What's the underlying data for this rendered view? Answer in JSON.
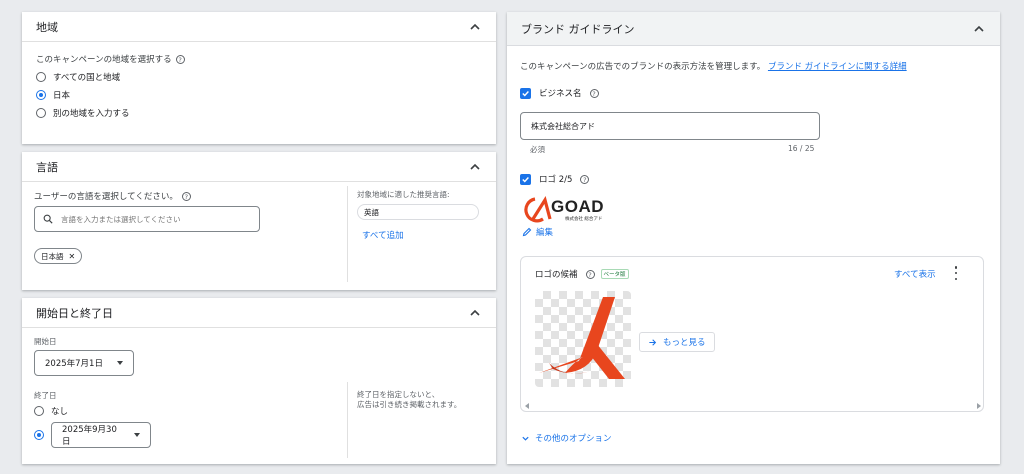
{
  "region": {
    "title": "地域",
    "prompt": "このキャンペーンの地域を選択する",
    "options": [
      "すべての国と地域",
      "日本",
      "別の地域を入力する"
    ],
    "selected_index": 1
  },
  "language": {
    "title": "言語",
    "prompt": "ユーザーの言語を選択してください。",
    "search_placeholder": "言語を入力または選択してください",
    "chip": "日本語",
    "recommend_title": "対象地域に適した推奨言語:",
    "recommend_chip": "英語",
    "add_all": "すべて追加"
  },
  "dates": {
    "title": "開始日と終了日",
    "start_label": "開始日",
    "start_value": "2025年7月1日",
    "end_label": "終了日",
    "end_none": "なし",
    "end_value": "2025年9月30日",
    "note_line1": "終了日を指定しないと、",
    "note_line2": "広告は引き続き掲載されます。"
  },
  "brand": {
    "title": "ブランド ガイドライン",
    "description": "このキャンペーンの広告でのブランドの表示方法を管理します。",
    "description_link": "ブランド ガイドラインに関する詳細",
    "business_label": "ビジネス名",
    "business_value": "株式会社総合アド",
    "required": "必須",
    "counter": "16 / 25",
    "logo_label": "ロゴ 2/5",
    "logo_text": "GOAD",
    "logo_subtext": "株式会社 総合アド",
    "edit": "編集",
    "candidates_title": "ロゴの候補",
    "candidates_badge": "ベータ版",
    "show_all": "すべて表示",
    "more": "もっと見る",
    "other_options": "その他のオプション"
  },
  "colors": {
    "accent": "#1a73e8",
    "logo_orange": "#e8461e"
  }
}
